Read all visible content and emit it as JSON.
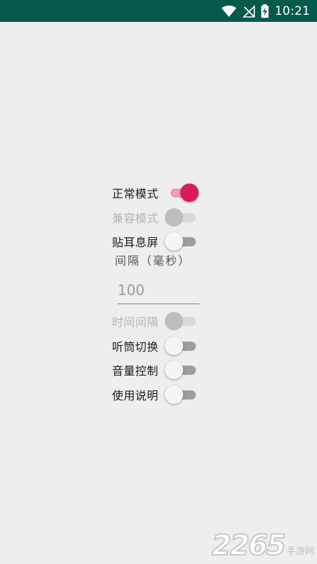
{
  "statusbar": {
    "time": "10:21",
    "icons": [
      "wifi-icon",
      "signal-off-icon",
      "battery-charging-icon"
    ]
  },
  "settings": [
    {
      "label": "正常模式",
      "state": "on",
      "enabled": true
    },
    {
      "label": "兼容模式",
      "state": "off",
      "enabled": false
    },
    {
      "label": "贴耳息屏",
      "state": "off",
      "enabled": true
    }
  ],
  "interval": {
    "caption": "间隔（毫秒）",
    "value": "100"
  },
  "settings2": [
    {
      "label": "时间间隔",
      "state": "off",
      "enabled": false
    },
    {
      "label": "听筒切换",
      "state": "off",
      "enabled": true
    },
    {
      "label": "音量控制",
      "state": "off",
      "enabled": true
    },
    {
      "label": "使用说明",
      "state": "off",
      "enabled": true
    }
  ],
  "watermark": {
    "number": "2265",
    "text": "手游网"
  },
  "colors": {
    "statusbar": "#075a4b",
    "background": "#eeeeee",
    "accent": "#d81b60",
    "accent_track": "#e8a0bb"
  }
}
